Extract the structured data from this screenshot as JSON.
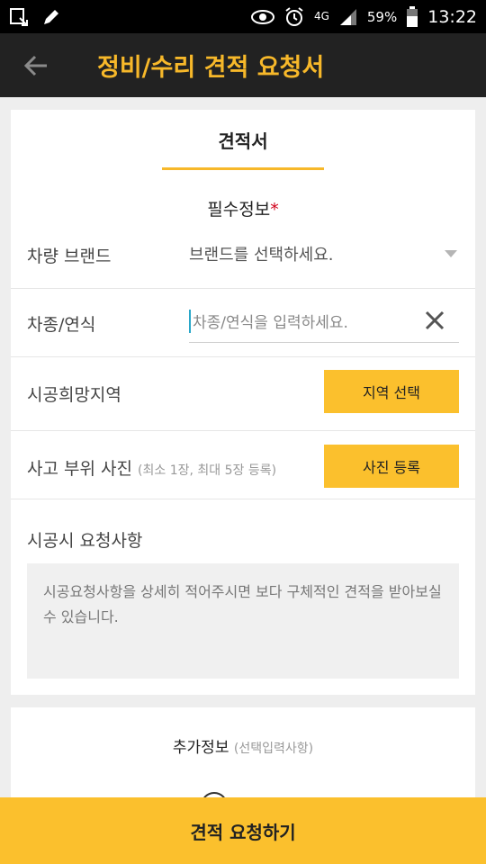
{
  "status_bar": {
    "battery": "59%",
    "network": "4G",
    "time": "13:22",
    "icons": [
      "download-icon",
      "pencil-icon",
      "eye-icon",
      "alarm-icon",
      "network-4g-icon",
      "signal-icon",
      "battery-icon"
    ]
  },
  "app_bar": {
    "title": "정비/수리 견적 요청서",
    "back_icon": "arrow-left-icon",
    "title_color": "#f7b82a",
    "background": "#222222"
  },
  "tab": {
    "label": "견적서",
    "accent": "#f7b82a"
  },
  "required_section": {
    "title": "필수정보",
    "required_mark": "*"
  },
  "form": {
    "brand": {
      "label": "차량 브랜드",
      "value": "브랜드를 선택하세요."
    },
    "model": {
      "label": "차종/연식",
      "placeholder": "차종/연식을 입력하세요."
    },
    "region": {
      "label": "시공희망지역",
      "button": "지역 선택"
    },
    "photo": {
      "label": "사고 부위 사진",
      "hint": "(최소 1장, 최대 5장 등록)",
      "button": "사진 등록"
    },
    "request": {
      "label": "시공시 요청사항",
      "placeholder": "시공요청사항을 상세히 적어주시면 보다 구체적인 견적을 받아보실 수 있습니다."
    }
  },
  "extra_section": {
    "title": "추가정보",
    "hint": "(선택입력사항)"
  },
  "submit_button": {
    "label": "견적 요청하기",
    "color": "#fbc02d"
  }
}
